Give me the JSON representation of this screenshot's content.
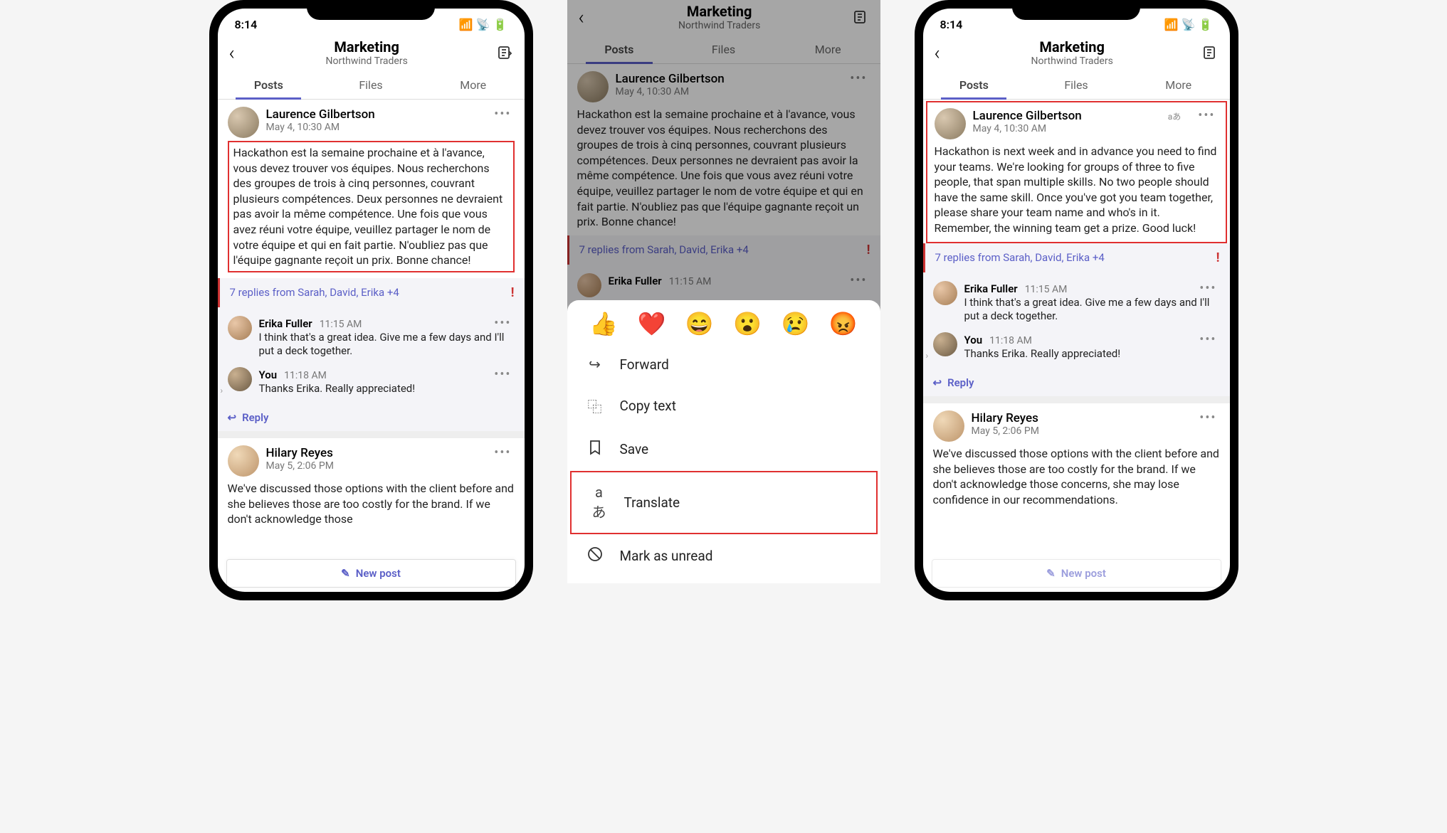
{
  "status": {
    "time": "8:14"
  },
  "header": {
    "title": "Marketing",
    "subtitle": "Northwind Traders"
  },
  "tabs": [
    "Posts",
    "Files",
    "More"
  ],
  "post_fr": {
    "author": "Laurence Gilbertson",
    "timestamp": "May 4, 10:30 AM",
    "body": "Hackathon est la semaine prochaine et à l'avance, vous devez trouver vos équipes. Nous recherchons des groupes de trois à cinq personnes, couvrant plusieurs compétences. Deux personnes ne devraient pas avoir la même compétence. Une fois que vous avez réuni votre équipe, veuillez partager le nom de votre équipe et qui en fait partie. N'oubliez pas que l'équipe gagnante reçoit un prix. Bonne chance!"
  },
  "post_en": {
    "author": "Laurence Gilbertson",
    "timestamp": "May 4, 10:30 AM",
    "body": "Hackathon is next week and in advance you need to find your teams. We're looking for groups of three to five people, that span multiple skills. No two people should have the same skill. Once you've got you team together, please share your team name and who's in it. Remember, the winning team get a prize. Good luck!"
  },
  "replies_summary": "7 replies from Sarah, David, Erika +4",
  "replies": [
    {
      "name": "Erika Fuller",
      "time": "11:15 AM",
      "text": "I think that's a great idea. Give me a few days and I'll put a deck together."
    },
    {
      "name": "You",
      "time": "11:18 AM",
      "text": "Thanks Erika. Really appreciated!"
    }
  ],
  "reply_label": "Reply",
  "post2": {
    "author": "Hilary Reyes",
    "timestamp": "May 5, 2:06 PM",
    "body_short": "We've discussed those options with the client before and she believes those are too costly for the brand. If we don't acknowledge those",
    "body_long": "We've discussed those options with the client before and she believes those are too costly for the brand. If we don't acknowledge those concerns, she may lose confidence in our recommendations."
  },
  "new_post_label": "New post",
  "reactions": [
    "👍",
    "❤️",
    "😄",
    "😮",
    "😢",
    "😡"
  ],
  "actions": {
    "forward": "Forward",
    "copy": "Copy text",
    "save": "Save",
    "translate": "Translate",
    "unread": "Mark as unread"
  },
  "reply_peek": {
    "name": "Erika Fuller",
    "time": "11:15 AM"
  },
  "translate_badge": "aあ"
}
